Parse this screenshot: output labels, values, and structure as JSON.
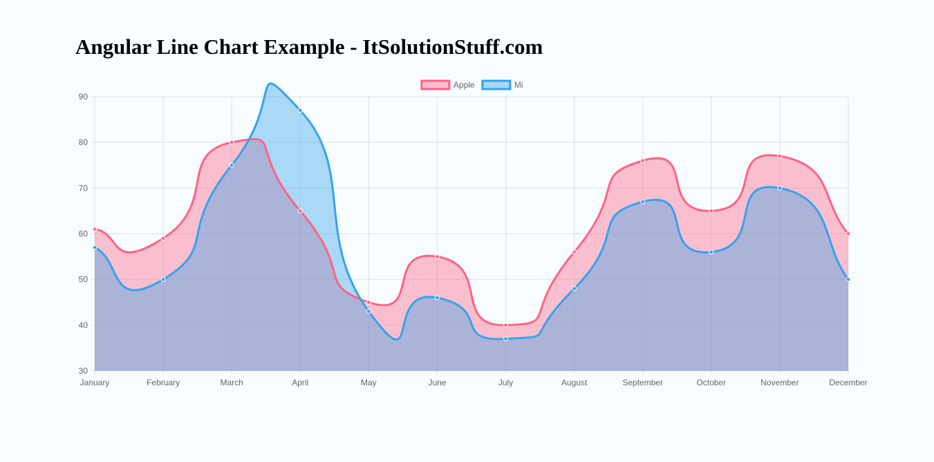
{
  "page": {
    "title": "Angular Line Chart Example - ItSolutionStuff.com"
  },
  "chart_data": {
    "type": "area",
    "title": "",
    "xlabel": "",
    "ylabel": "",
    "categories": [
      "January",
      "February",
      "March",
      "April",
      "May",
      "June",
      "July",
      "August",
      "September",
      "October",
      "November",
      "December"
    ],
    "ylim": [
      30,
      90
    ],
    "yticks": [
      30,
      40,
      50,
      60,
      70,
      80,
      90
    ],
    "grid": true,
    "legend_position": "top-center",
    "curve": "smooth",
    "series": [
      {
        "name": "Apple",
        "values": [
          61,
          59,
          80,
          65,
          45,
          55,
          40,
          56,
          76,
          65,
          77,
          60
        ],
        "line_color": "#ff6384",
        "fill_color": "rgba(255,99,132,0.4)"
      },
      {
        "name": "Mi",
        "values": [
          57,
          50,
          75,
          87,
          43,
          46,
          37,
          48,
          67,
          56,
          70,
          50
        ],
        "line_color": "#36a2eb",
        "fill_color": "rgba(54,162,235,0.4)"
      }
    ]
  }
}
